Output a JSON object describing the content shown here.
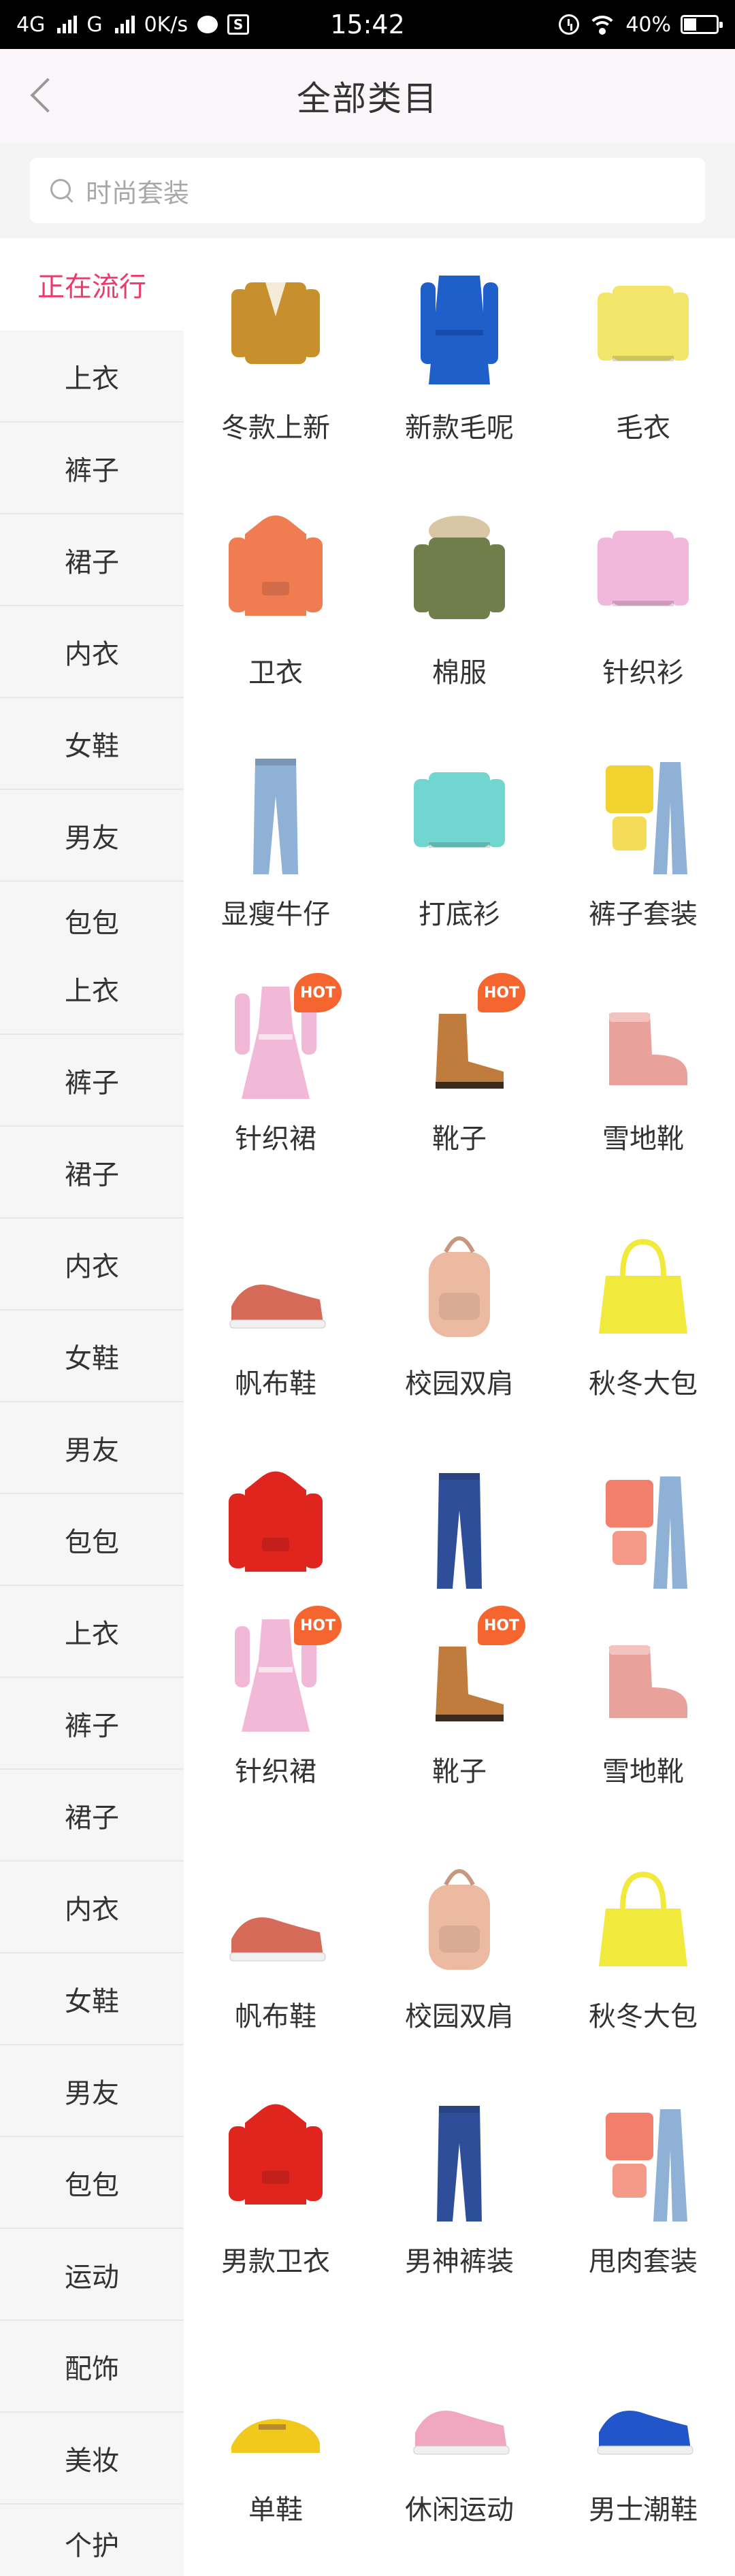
{
  "status_bar": {
    "carrier1": "4G",
    "carrier2": "G",
    "net_speed": "0K/s",
    "time": "15:42",
    "battery": "40%",
    "battery_level": 0.4
  },
  "header": {
    "title": "全部类目",
    "back_icon": "chevron-left-icon"
  },
  "search": {
    "placeholder": "时尚套装",
    "icon": "search-icon"
  },
  "sidebar": {
    "accent": "#ee3a6a",
    "items": [
      {
        "label": "正在流行",
        "active": true
      },
      {
        "label": "上衣"
      },
      {
        "label": "裤子"
      },
      {
        "label": "裙子"
      },
      {
        "label": "内衣"
      },
      {
        "label": "女鞋"
      },
      {
        "label": "男友"
      },
      {
        "label": "包包"
      },
      {
        "label": "上衣"
      },
      {
        "label": "裤子"
      },
      {
        "label": "裙子"
      },
      {
        "label": "内衣"
      },
      {
        "label": "女鞋"
      },
      {
        "label": "男友"
      },
      {
        "label": "包包"
      },
      {
        "label": "上衣"
      },
      {
        "label": "裤子"
      },
      {
        "label": "裙子"
      },
      {
        "label": "内衣"
      },
      {
        "label": "女鞋"
      },
      {
        "label": "男友"
      },
      {
        "label": "包包"
      },
      {
        "label": "运动"
      },
      {
        "label": "配饰"
      },
      {
        "label": "美妆"
      },
      {
        "label": "个护"
      }
    ]
  },
  "grid": {
    "hot_label": "HOT",
    "items": [
      {
        "label": "冬款上新",
        "icon": "jacket-icon",
        "color": "#c8902c"
      },
      {
        "label": "新款毛呢",
        "icon": "coat-icon",
        "color": "#1f5fc9"
      },
      {
        "label": "毛衣",
        "icon": "sweater-icon",
        "color": "#f3e46a"
      },
      {
        "label": "卫衣",
        "icon": "hoodie-icon",
        "color": "#f07c52"
      },
      {
        "label": "棉服",
        "icon": "parka-icon",
        "color": "#6f7e4a"
      },
      {
        "label": "针织衫",
        "icon": "sweater-icon",
        "color": "#f1b8dc"
      },
      {
        "label": "显瘦牛仔",
        "icon": "jeans-icon",
        "color": "#8fb1d6"
      },
      {
        "label": "打底衫",
        "icon": "sweater-icon",
        "color": "#71d6cf"
      },
      {
        "label": "裤子套装",
        "icon": "outfit-icon",
        "color": "#f1d22e"
      },
      {
        "label": "针织裙",
        "icon": "dress-icon",
        "color": "#f2b8d8",
        "hot": true
      },
      {
        "label": "靴子",
        "icon": "boot-icon",
        "color": "#c07c3d",
        "hot": true
      },
      {
        "label": "雪地靴",
        "icon": "snow-boot-icon",
        "color": "#e9a19b"
      },
      {
        "label": "帆布鞋",
        "icon": "sneaker-icon",
        "color": "#d66b5a"
      },
      {
        "label": "校园双肩",
        "icon": "backpack-icon",
        "color": "#ecb9a1"
      },
      {
        "label": "秋冬大包",
        "icon": "handbag-icon",
        "color": "#f1ea3c"
      },
      {
        "label": "",
        "icon": "hoodie-icon",
        "color": "#e0251f"
      },
      {
        "label": "",
        "icon": "jeans-icon",
        "color": "#2f4e9a"
      },
      {
        "label": "",
        "icon": "outfit-icon",
        "color": "#f27f6c"
      },
      {
        "label": "针织裙",
        "icon": "dress-icon",
        "color": "#f2b8d8",
        "hot": true
      },
      {
        "label": "靴子",
        "icon": "boot-icon",
        "color": "#c07c3d",
        "hot": true
      },
      {
        "label": "雪地靴",
        "icon": "snow-boot-icon",
        "color": "#e9a19b"
      },
      {
        "label": "帆布鞋",
        "icon": "sneaker-icon",
        "color": "#d66b5a"
      },
      {
        "label": "校园双肩",
        "icon": "backpack-icon",
        "color": "#ecb9a1"
      },
      {
        "label": "秋冬大包",
        "icon": "handbag-icon",
        "color": "#f1ea3c"
      },
      {
        "label": "男款卫衣",
        "icon": "hoodie-icon",
        "color": "#e0251f"
      },
      {
        "label": "男神裤装",
        "icon": "jeans-icon",
        "color": "#2f4e9a"
      },
      {
        "label": "甩肉套装",
        "icon": "outfit-icon",
        "color": "#f27f6c"
      },
      {
        "label": "单鞋",
        "icon": "loafer-icon",
        "color": "#f1c91d"
      },
      {
        "label": "休闲运动",
        "icon": "sneaker-icon",
        "color": "#f0a8c0"
      },
      {
        "label": "男士潮鞋",
        "icon": "sneaker-icon",
        "color": "#2155c9"
      }
    ]
  }
}
